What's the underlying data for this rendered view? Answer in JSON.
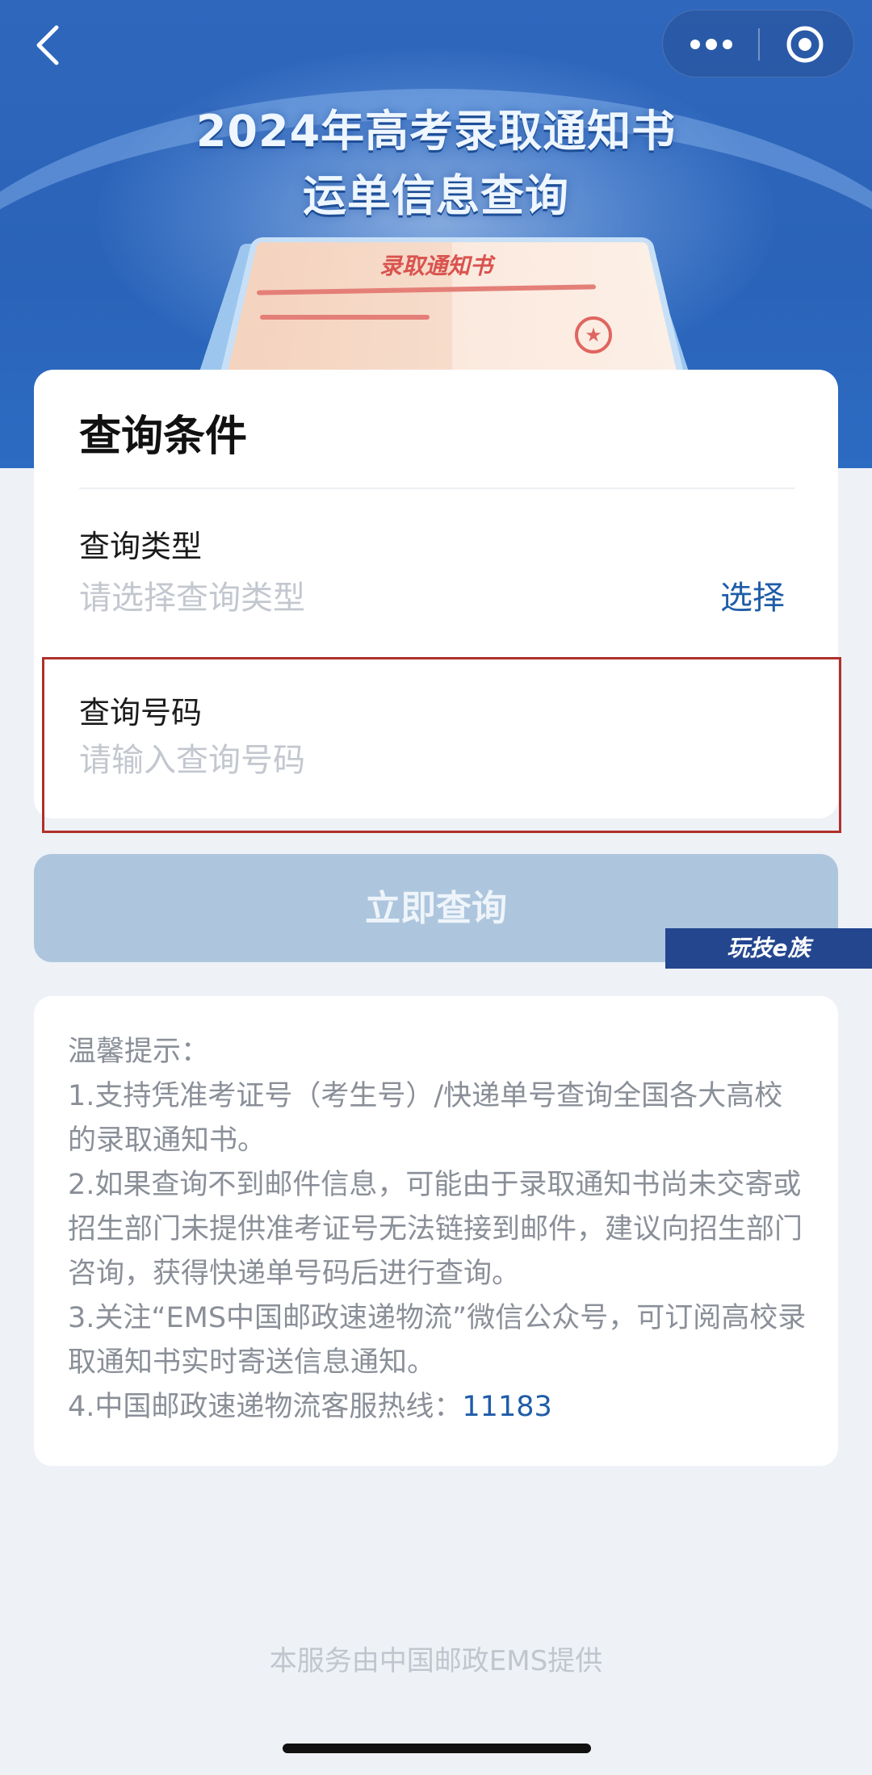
{
  "banner": {
    "title_line1": "2024年高考录取通知书",
    "title_line2": "运单信息查询",
    "letter_heading": "录取通知书",
    "seal_glyph": "★"
  },
  "nav": {
    "back_icon": "chevron-left-icon",
    "more_icon": "more-dots-icon",
    "close_icon": "target-close-icon"
  },
  "query_card": {
    "title": "查询条件",
    "type_label": "查询类型",
    "type_placeholder": "请选择查询类型",
    "select_label": "选择",
    "number_label": "查询号码",
    "number_placeholder": "请输入查询号码",
    "number_value": ""
  },
  "submit_label": "立即查询",
  "watermark_text": "玩技e族",
  "tips": {
    "heading": "温馨提示：",
    "item1": "1.支持凭准考证号（考生号）/快递单号查询全国各大高校的录取通知书。",
    "item2": "2.如果查询不到邮件信息，可能由于录取通知书尚未交寄或招生部门未提供准考证号无法链接到邮件，建议向招生部门咨询，获得快递单号码后进行查询。",
    "item3": "3.关注“EMS中国邮政速递物流”微信公众号，可订阅高校录取通知书实时寄送信息通知。",
    "item4_prefix": "4.中国邮政速递物流客服热线：",
    "hotline": "11183"
  },
  "footer": "本服务由中国邮政EMS提供",
  "colors": {
    "banner_blue": "#2a63b8",
    "link_blue": "#1f5da8",
    "button_disabled": "#adc6de",
    "highlight_red": "#b0302a",
    "page_bg": "#eef1f6"
  }
}
